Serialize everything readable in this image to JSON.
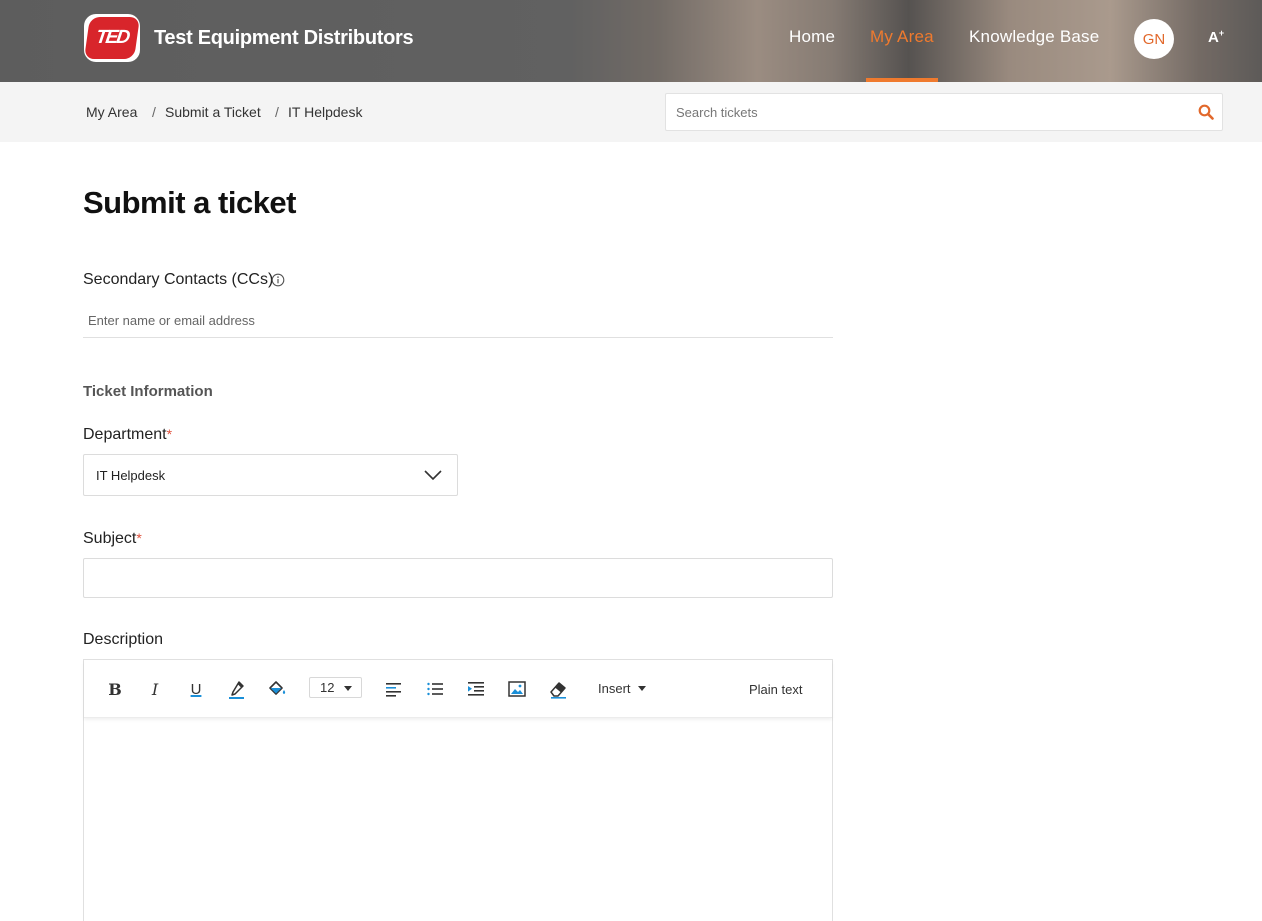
{
  "header": {
    "logo_text": "TED",
    "brand": "Test Equipment Distributors",
    "nav": {
      "home": "Home",
      "my_area": "My Area",
      "knowledge_base": "Knowledge Base"
    },
    "avatar_initials": "GN",
    "a11y_label": "A",
    "a11y_sup": "+",
    "accent_color": "#ef7a2e"
  },
  "breadcrumb": {
    "items": [
      "My Area",
      "Submit a Ticket",
      "IT Helpdesk"
    ],
    "separator": "/"
  },
  "search": {
    "placeholder": "Search tickets",
    "value": ""
  },
  "page": {
    "title": "Submit a ticket"
  },
  "form": {
    "cc": {
      "label": "Secondary Contacts (CCs)",
      "placeholder": "Enter name or email address",
      "value": ""
    },
    "section_title": "Ticket Information",
    "department": {
      "label": "Department",
      "required_mark": "*",
      "value": "IT Helpdesk"
    },
    "subject": {
      "label": "Subject",
      "required_mark": "*",
      "value": ""
    },
    "description": {
      "label": "Description",
      "value": ""
    }
  },
  "editor": {
    "toolbar": {
      "bold": "B",
      "italic": "I",
      "underline": "U",
      "font_size": "12",
      "insert": "Insert",
      "plain_text": "Plain text"
    }
  }
}
